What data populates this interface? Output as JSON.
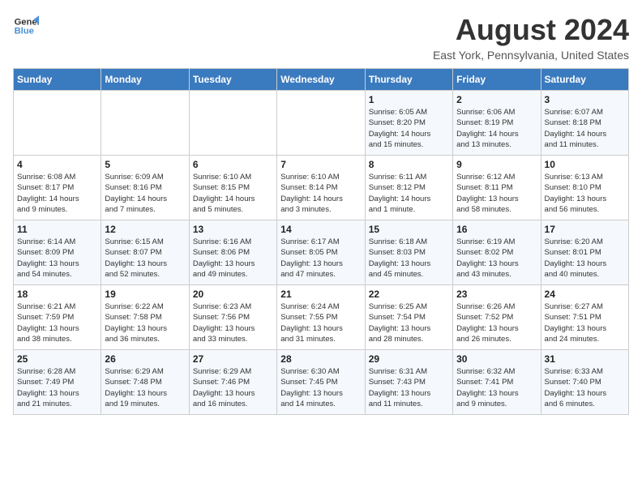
{
  "logo": {
    "line1": "General",
    "line2": "Blue"
  },
  "title": "August 2024",
  "location": "East York, Pennsylvania, United States",
  "days_of_week": [
    "Sunday",
    "Monday",
    "Tuesday",
    "Wednesday",
    "Thursday",
    "Friday",
    "Saturday"
  ],
  "weeks": [
    [
      {
        "num": "",
        "info": ""
      },
      {
        "num": "",
        "info": ""
      },
      {
        "num": "",
        "info": ""
      },
      {
        "num": "",
        "info": ""
      },
      {
        "num": "1",
        "info": "Sunrise: 6:05 AM\nSunset: 8:20 PM\nDaylight: 14 hours\nand 15 minutes."
      },
      {
        "num": "2",
        "info": "Sunrise: 6:06 AM\nSunset: 8:19 PM\nDaylight: 14 hours\nand 13 minutes."
      },
      {
        "num": "3",
        "info": "Sunrise: 6:07 AM\nSunset: 8:18 PM\nDaylight: 14 hours\nand 11 minutes."
      }
    ],
    [
      {
        "num": "4",
        "info": "Sunrise: 6:08 AM\nSunset: 8:17 PM\nDaylight: 14 hours\nand 9 minutes."
      },
      {
        "num": "5",
        "info": "Sunrise: 6:09 AM\nSunset: 8:16 PM\nDaylight: 14 hours\nand 7 minutes."
      },
      {
        "num": "6",
        "info": "Sunrise: 6:10 AM\nSunset: 8:15 PM\nDaylight: 14 hours\nand 5 minutes."
      },
      {
        "num": "7",
        "info": "Sunrise: 6:10 AM\nSunset: 8:14 PM\nDaylight: 14 hours\nand 3 minutes."
      },
      {
        "num": "8",
        "info": "Sunrise: 6:11 AM\nSunset: 8:12 PM\nDaylight: 14 hours\nand 1 minute."
      },
      {
        "num": "9",
        "info": "Sunrise: 6:12 AM\nSunset: 8:11 PM\nDaylight: 13 hours\nand 58 minutes."
      },
      {
        "num": "10",
        "info": "Sunrise: 6:13 AM\nSunset: 8:10 PM\nDaylight: 13 hours\nand 56 minutes."
      }
    ],
    [
      {
        "num": "11",
        "info": "Sunrise: 6:14 AM\nSunset: 8:09 PM\nDaylight: 13 hours\nand 54 minutes."
      },
      {
        "num": "12",
        "info": "Sunrise: 6:15 AM\nSunset: 8:07 PM\nDaylight: 13 hours\nand 52 minutes."
      },
      {
        "num": "13",
        "info": "Sunrise: 6:16 AM\nSunset: 8:06 PM\nDaylight: 13 hours\nand 49 minutes."
      },
      {
        "num": "14",
        "info": "Sunrise: 6:17 AM\nSunset: 8:05 PM\nDaylight: 13 hours\nand 47 minutes."
      },
      {
        "num": "15",
        "info": "Sunrise: 6:18 AM\nSunset: 8:03 PM\nDaylight: 13 hours\nand 45 minutes."
      },
      {
        "num": "16",
        "info": "Sunrise: 6:19 AM\nSunset: 8:02 PM\nDaylight: 13 hours\nand 43 minutes."
      },
      {
        "num": "17",
        "info": "Sunrise: 6:20 AM\nSunset: 8:01 PM\nDaylight: 13 hours\nand 40 minutes."
      }
    ],
    [
      {
        "num": "18",
        "info": "Sunrise: 6:21 AM\nSunset: 7:59 PM\nDaylight: 13 hours\nand 38 minutes."
      },
      {
        "num": "19",
        "info": "Sunrise: 6:22 AM\nSunset: 7:58 PM\nDaylight: 13 hours\nand 36 minutes."
      },
      {
        "num": "20",
        "info": "Sunrise: 6:23 AM\nSunset: 7:56 PM\nDaylight: 13 hours\nand 33 minutes."
      },
      {
        "num": "21",
        "info": "Sunrise: 6:24 AM\nSunset: 7:55 PM\nDaylight: 13 hours\nand 31 minutes."
      },
      {
        "num": "22",
        "info": "Sunrise: 6:25 AM\nSunset: 7:54 PM\nDaylight: 13 hours\nand 28 minutes."
      },
      {
        "num": "23",
        "info": "Sunrise: 6:26 AM\nSunset: 7:52 PM\nDaylight: 13 hours\nand 26 minutes."
      },
      {
        "num": "24",
        "info": "Sunrise: 6:27 AM\nSunset: 7:51 PM\nDaylight: 13 hours\nand 24 minutes."
      }
    ],
    [
      {
        "num": "25",
        "info": "Sunrise: 6:28 AM\nSunset: 7:49 PM\nDaylight: 13 hours\nand 21 minutes."
      },
      {
        "num": "26",
        "info": "Sunrise: 6:29 AM\nSunset: 7:48 PM\nDaylight: 13 hours\nand 19 minutes."
      },
      {
        "num": "27",
        "info": "Sunrise: 6:29 AM\nSunset: 7:46 PM\nDaylight: 13 hours\nand 16 minutes."
      },
      {
        "num": "28",
        "info": "Sunrise: 6:30 AM\nSunset: 7:45 PM\nDaylight: 13 hours\nand 14 minutes."
      },
      {
        "num": "29",
        "info": "Sunrise: 6:31 AM\nSunset: 7:43 PM\nDaylight: 13 hours\nand 11 minutes."
      },
      {
        "num": "30",
        "info": "Sunrise: 6:32 AM\nSunset: 7:41 PM\nDaylight: 13 hours\nand 9 minutes."
      },
      {
        "num": "31",
        "info": "Sunrise: 6:33 AM\nSunset: 7:40 PM\nDaylight: 13 hours\nand 6 minutes."
      }
    ]
  ]
}
